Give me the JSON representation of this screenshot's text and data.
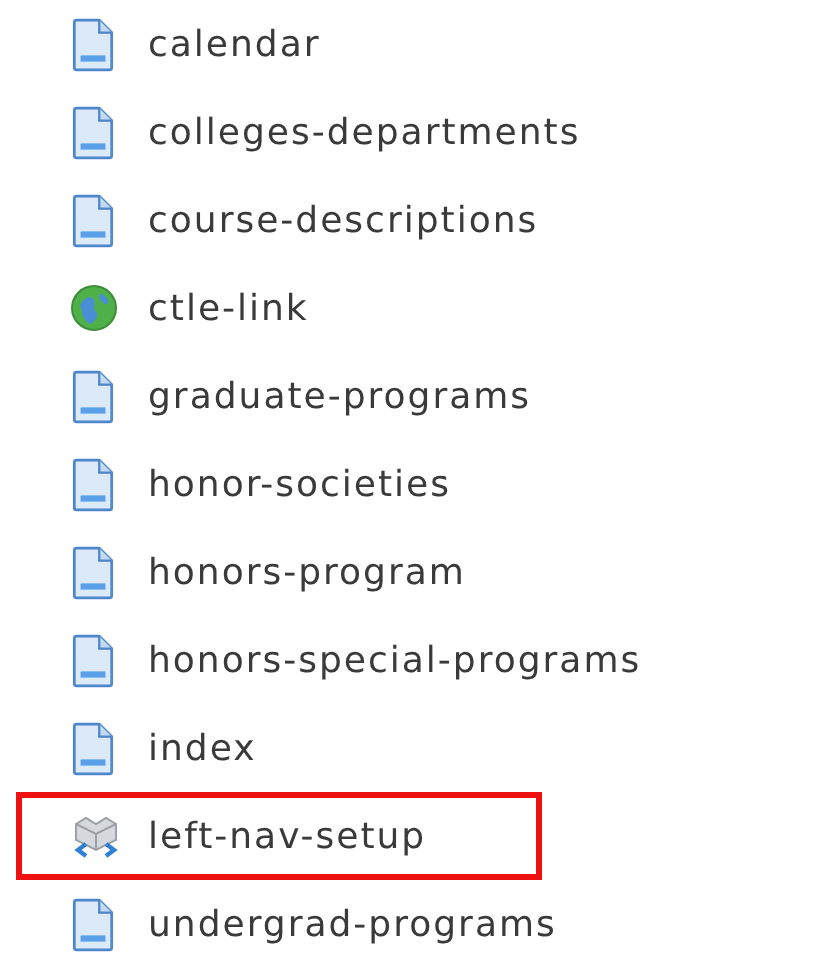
{
  "items": [
    {
      "name": "calendar",
      "kind": "page",
      "highlighted": false
    },
    {
      "name": "colleges-departments",
      "kind": "page",
      "highlighted": false
    },
    {
      "name": "course-descriptions",
      "kind": "page",
      "highlighted": false
    },
    {
      "name": "ctle-link",
      "kind": "link",
      "highlighted": false
    },
    {
      "name": "graduate-programs",
      "kind": "page",
      "highlighted": false
    },
    {
      "name": "honor-societies",
      "kind": "page",
      "highlighted": false
    },
    {
      "name": "honors-program",
      "kind": "page",
      "highlighted": false
    },
    {
      "name": "honors-special-programs",
      "kind": "page",
      "highlighted": false
    },
    {
      "name": "index",
      "kind": "page",
      "highlighted": false
    },
    {
      "name": "left-nav-setup",
      "kind": "block",
      "highlighted": true
    },
    {
      "name": "undergrad-programs",
      "kind": "page",
      "highlighted": false
    }
  ]
}
